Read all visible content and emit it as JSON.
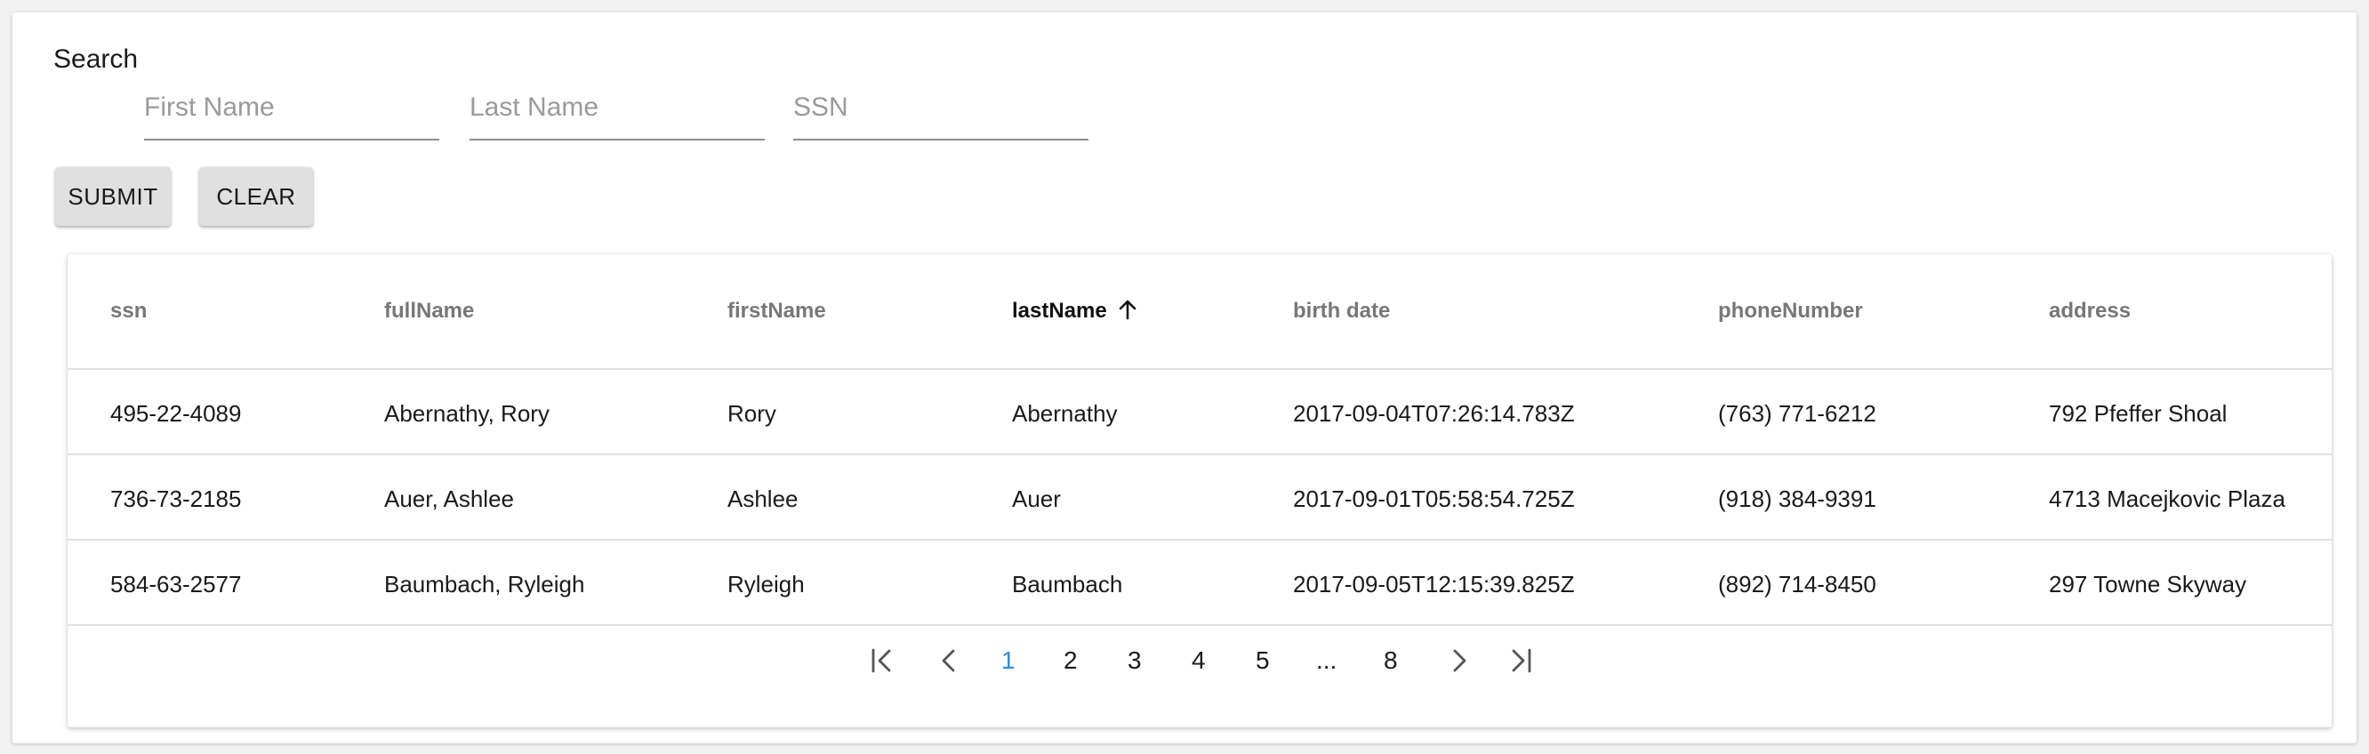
{
  "search": {
    "title": "Search",
    "first_name_placeholder": "First Name",
    "last_name_placeholder": "Last Name",
    "ssn_placeholder": "SSN",
    "submit_label": "SUBMIT",
    "clear_label": "CLEAR"
  },
  "table": {
    "columns": [
      "ssn",
      "fullName",
      "firstName",
      "lastName",
      "birth date",
      "phoneNumber",
      "address"
    ],
    "sorted_column": "lastName",
    "sort_direction": "ascending",
    "rows": [
      [
        "495-22-4089",
        "Abernathy, Rory",
        "Rory",
        "Abernathy",
        "2017-09-04T07:26:14.783Z",
        "(763) 771-6212",
        "792 Pfeffer Shoal"
      ],
      [
        "736-73-2185",
        "Auer, Ashlee",
        "Ashlee",
        "Auer",
        "2017-09-01T05:58:54.725Z",
        "(918) 384-9391",
        "4713 Macejkovic Plaza"
      ],
      [
        "584-63-2577",
        "Baumbach, Ryleigh",
        "Ryleigh",
        "Baumbach",
        "2017-09-05T12:15:39.825Z",
        "(892) 714-8450",
        "297 Towne Skyway"
      ]
    ]
  },
  "pagination": {
    "pages": [
      "1",
      "2",
      "3",
      "4",
      "5",
      "...",
      "8"
    ],
    "current_page": "1",
    "icons": [
      "first-page-icon",
      "previous-page-icon",
      "next-page-icon",
      "last-page-icon"
    ],
    "active_color": "#2a8fd6"
  },
  "colors": {
    "button_bg": "#e0e0e0",
    "header_text": "#777777",
    "divider": "#e0e0e0"
  }
}
